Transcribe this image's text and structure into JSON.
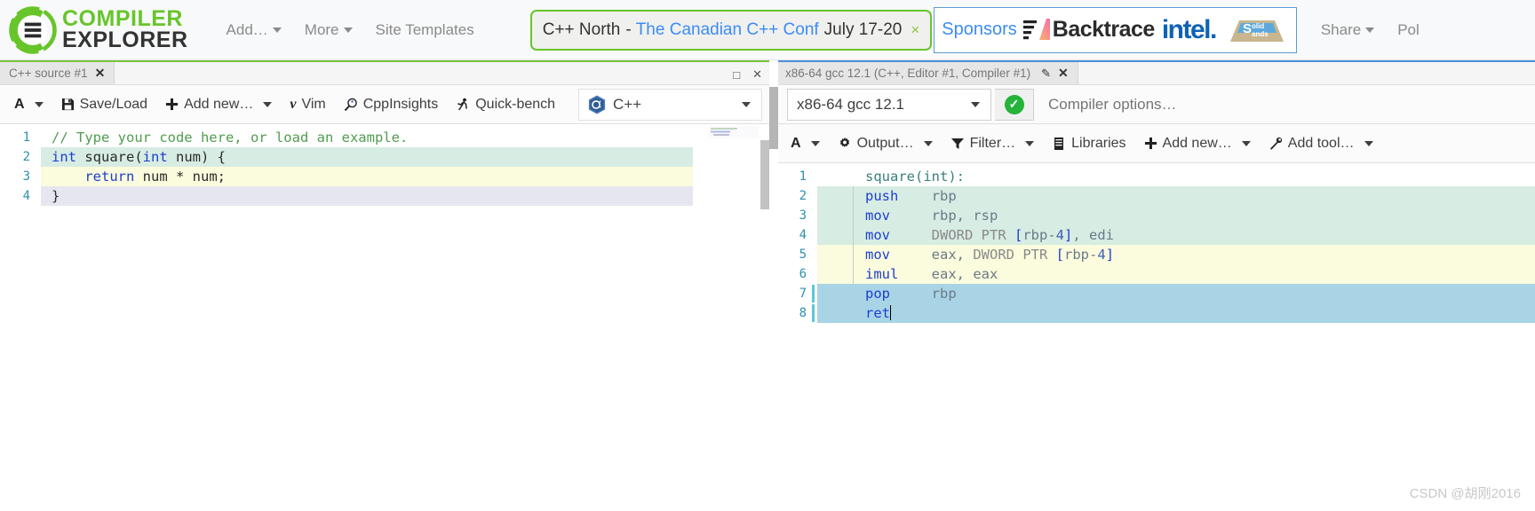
{
  "brand": {
    "line1": "COMPILER",
    "line2": "EXPLORER",
    "logo_icon": "compiler-explorer-gear-logo"
  },
  "navbar": {
    "links": [
      {
        "label": "Add…",
        "has_caret": true
      },
      {
        "label": "More",
        "has_caret": true
      },
      {
        "label": "Site Templates",
        "has_caret": false
      }
    ],
    "right_links": [
      {
        "label": "Share",
        "has_caret": true
      },
      {
        "label": "Pol",
        "has_caret": false
      }
    ],
    "conference_banner": {
      "title": "C++ North",
      "dash": "-",
      "link_text": "The Canadian C++ Conf",
      "date": "July 17-20",
      "close_label": "×"
    },
    "sponsors": {
      "label": "Sponsors",
      "items": [
        {
          "name": "Backtrace",
          "icon": "backtrace-logo"
        },
        {
          "name": "intel.",
          "icon": "intel-logo"
        },
        {
          "name": "Solid Sands",
          "icon": "solid-sands-logo"
        }
      ]
    }
  },
  "editor_pane": {
    "tab": {
      "title": "C++ source #1",
      "close_label": "✕"
    },
    "window_controls": {
      "maximize": "□",
      "close": "✕"
    },
    "toolbar": [
      {
        "label": "",
        "icon": "font-size-A-icon",
        "caret": true
      },
      {
        "label": "Save/Load",
        "icon": "save-icon",
        "caret": false
      },
      {
        "label": "Add new…",
        "icon": "plus-icon",
        "caret": true
      },
      {
        "label": "Vim",
        "icon": "vim-icon",
        "caret": false
      },
      {
        "label": "CppInsights",
        "icon": "magnifier-icon",
        "caret": false
      },
      {
        "label": "Quick-bench",
        "icon": "runner-icon",
        "caret": false
      }
    ],
    "language_select": {
      "value": "C++",
      "icon": "cpp-hex-icon"
    },
    "code_lines": [
      {
        "n": "1",
        "hl": "none",
        "tokens": [
          {
            "t": "// Type your code here, or load an example.",
            "c": "t-comment"
          }
        ]
      },
      {
        "n": "2",
        "hl": "green",
        "tokens": [
          {
            "t": "int",
            "c": "t-kw"
          },
          {
            "t": " square(",
            "c": "t-plain"
          },
          {
            "t": "int",
            "c": "t-kw"
          },
          {
            "t": " num) {",
            "c": "t-plain"
          }
        ]
      },
      {
        "n": "3",
        "hl": "yellow",
        "tokens": [
          {
            "t": "    ",
            "c": "t-plain"
          },
          {
            "t": "return",
            "c": "t-kw"
          },
          {
            "t": " num * num;",
            "c": "t-plain"
          }
        ]
      },
      {
        "n": "4",
        "hl": "lav",
        "tokens": [
          {
            "t": "}",
            "c": "t-plain"
          }
        ]
      }
    ]
  },
  "compiler_pane": {
    "tab": {
      "title": "x86-64 gcc 12.1 (C++, Editor #1, Compiler #1)",
      "edit_label": "✎",
      "close_label": "✕"
    },
    "compiler_select": {
      "value": "x86-64 gcc 12.1"
    },
    "status": {
      "icon": "check-circle-icon",
      "state": "ok"
    },
    "options": {
      "placeholder": "Compiler options…",
      "value": ""
    },
    "toolbar": [
      {
        "label": "",
        "icon": "font-size-A-icon",
        "caret": true
      },
      {
        "label": "Output…",
        "icon": "gear-icon",
        "caret": true
      },
      {
        "label": "Filter…",
        "icon": "funnel-icon",
        "caret": true
      },
      {
        "label": "Libraries",
        "icon": "books-icon",
        "caret": false
      },
      {
        "label": "Add new…",
        "icon": "plus-icon",
        "caret": true
      },
      {
        "label": "Add tool…",
        "icon": "wrench-icon",
        "caret": true
      }
    ],
    "asm_lines": [
      {
        "n": "1",
        "hl": "none",
        "marker": false,
        "tokens": [
          {
            "t": "square(int):",
            "c": "t-label"
          }
        ]
      },
      {
        "n": "2",
        "hl": "green",
        "marker": true,
        "tokens": [
          {
            "t": "push",
            "c": "t-mn"
          },
          {
            "t": "    ",
            "c": "t-plain"
          },
          {
            "t": "rbp",
            "c": "t-reg"
          }
        ]
      },
      {
        "n": "3",
        "hl": "green",
        "marker": true,
        "tokens": [
          {
            "t": "mov",
            "c": "t-mn"
          },
          {
            "t": "     ",
            "c": "t-plain"
          },
          {
            "t": "rbp, rsp",
            "c": "t-reg"
          }
        ]
      },
      {
        "n": "4",
        "hl": "green",
        "marker": true,
        "tokens": [
          {
            "t": "mov",
            "c": "t-mn"
          },
          {
            "t": "     ",
            "c": "t-plain"
          },
          {
            "t": "DWORD PTR ",
            "c": "t-ptr"
          },
          {
            "t": "[",
            "c": "t-brk"
          },
          {
            "t": "rbp-",
            "c": "t-reg"
          },
          {
            "t": "4",
            "c": "t-num"
          },
          {
            "t": "]",
            "c": "t-brk"
          },
          {
            "t": ", edi",
            "c": "t-reg"
          }
        ]
      },
      {
        "n": "5",
        "hl": "yellow",
        "marker": true,
        "tokens": [
          {
            "t": "mov",
            "c": "t-mn"
          },
          {
            "t": "     ",
            "c": "t-plain"
          },
          {
            "t": "eax, ",
            "c": "t-reg"
          },
          {
            "t": "DWORD PTR ",
            "c": "t-ptr"
          },
          {
            "t": "[",
            "c": "t-brk"
          },
          {
            "t": "rbp-",
            "c": "t-reg"
          },
          {
            "t": "4",
            "c": "t-num"
          },
          {
            "t": "]",
            "c": "t-brk"
          }
        ]
      },
      {
        "n": "6",
        "hl": "yellow",
        "marker": true,
        "tokens": [
          {
            "t": "imul",
            "c": "t-mn"
          },
          {
            "t": "    ",
            "c": "t-plain"
          },
          {
            "t": "eax, eax",
            "c": "t-reg"
          }
        ]
      },
      {
        "n": "7",
        "hl": "blue",
        "marker": false,
        "tokens": [
          {
            "t": "pop",
            "c": "t-mn"
          },
          {
            "t": "     ",
            "c": "t-plain"
          },
          {
            "t": "rbp",
            "c": "t-reg"
          }
        ]
      },
      {
        "n": "8",
        "hl": "blue",
        "marker": false,
        "tokens": [
          {
            "t": "ret",
            "c": "t-mn"
          }
        ],
        "caret": true
      }
    ]
  },
  "watermark": {
    "text": "CSDN @胡刚2016"
  },
  "colors": {
    "brand_green": "#67c52a",
    "link_blue": "#3b8cf5",
    "banner_border": "#67c52a",
    "sponsor_border": "#5b9bd5",
    "status_green": "#25b33a",
    "editor_tab_accent": "#76c442",
    "compiler_tab_accent": "#4a90d9"
  }
}
